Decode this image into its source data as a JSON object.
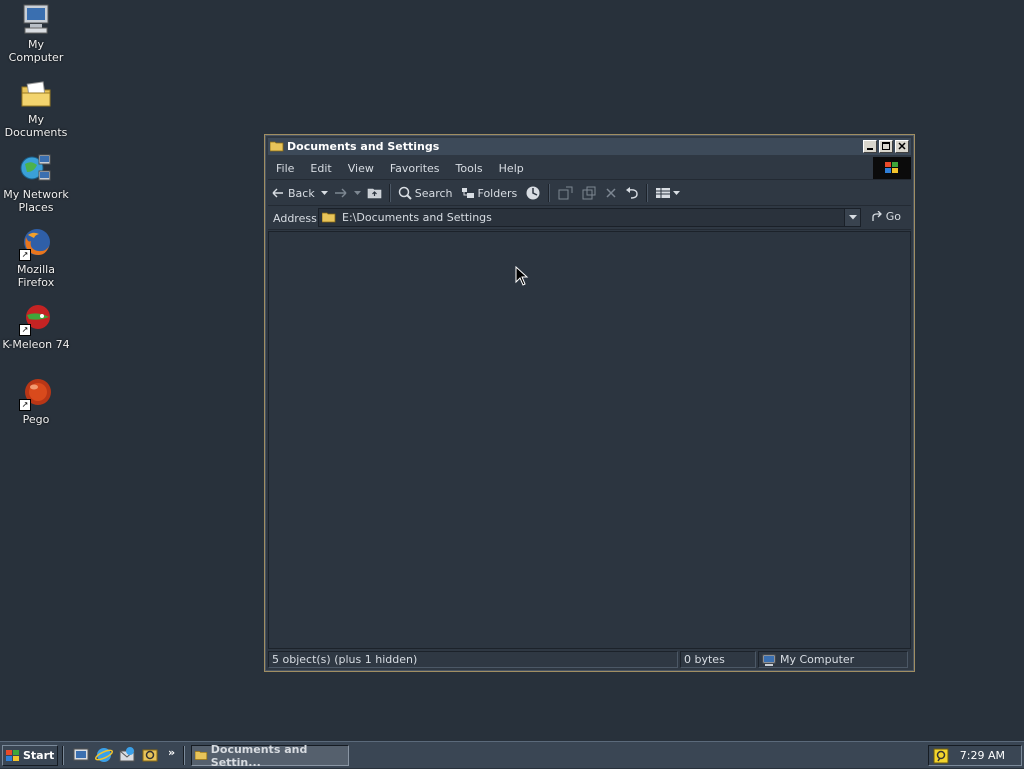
{
  "desktop": {
    "icons": [
      {
        "label": "My Computer",
        "icon": "computer-icon"
      },
      {
        "label": "My Documents",
        "icon": "folder-documents-icon"
      },
      {
        "label1": "My Network",
        "label2": "Places",
        "icon": "network-icon"
      },
      {
        "label": "Mozilla Firefox",
        "icon": "firefox-icon"
      },
      {
        "label": "K-Meleon 74",
        "icon": "kmeleon-icon"
      },
      {
        "label": "Pego",
        "icon": "pego-icon"
      }
    ]
  },
  "window": {
    "title": "Documents and Settings",
    "menu": [
      "File",
      "Edit",
      "View",
      "Favorites",
      "Tools",
      "Help"
    ],
    "toolbar": {
      "back": "Back",
      "search": "Search",
      "folders": "Folders"
    },
    "address": {
      "label": "Address",
      "path": "E:\\Documents and Settings",
      "go": "Go"
    },
    "status": {
      "objects": "5 object(s) (plus 1 hidden)",
      "size": "0 bytes",
      "location": "My Computer"
    }
  },
  "taskbar": {
    "start": "Start",
    "task": "Documents and Settin...",
    "clock": "7:29 AM"
  },
  "colors": {
    "desktop": "#28313b",
    "window_bg": "#2f3843",
    "titlebar": "#3d4a59",
    "taskbar": "#3a4654"
  }
}
